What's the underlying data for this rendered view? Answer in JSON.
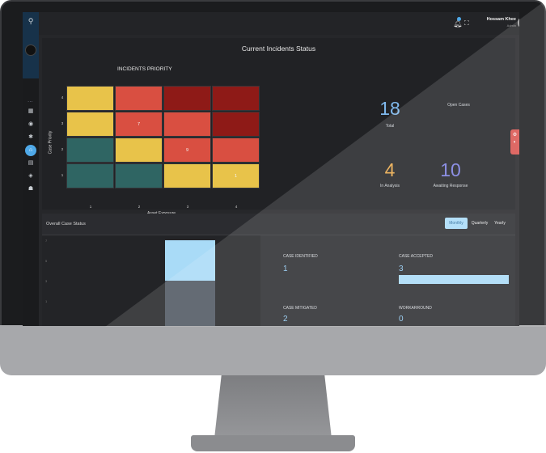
{
  "sidebar": {
    "logo_icon": "shield-logo-icon",
    "dots": "...",
    "items": [
      {
        "icon": "calendar-icon",
        "glyph": "▦"
      },
      {
        "icon": "clock-icon",
        "glyph": "◉"
      },
      {
        "icon": "bug-icon",
        "glyph": "✱"
      },
      {
        "icon": "home-icon",
        "glyph": "⌂",
        "active": true
      },
      {
        "icon": "chat-icon",
        "glyph": "▤"
      },
      {
        "icon": "location-icon",
        "glyph": "◈"
      },
      {
        "icon": "users-icon",
        "glyph": "☗"
      }
    ]
  },
  "topbar": {
    "bell_icon": "bell-icon",
    "expand_icon": "fullscreen-icon",
    "user_name": "Hossam Khee",
    "user_role": "Admin"
  },
  "incidents": {
    "title": "Current Incidents Status",
    "heatmap_title": "INCIDENTS PRIORITY",
    "y_axis_label": "Case Priority",
    "x_axis_label": "Asset Exposure",
    "y_ticks": [
      "4",
      "3",
      "2",
      "1"
    ],
    "x_ticks": [
      "1",
      "2",
      "3",
      "4"
    ],
    "cells": [
      {
        "row": 4,
        "col": 1,
        "color": "#e8c34a",
        "value": ""
      },
      {
        "row": 4,
        "col": 2,
        "color": "#d94f41",
        "value": ""
      },
      {
        "row": 4,
        "col": 3,
        "color": "#8e1a17",
        "value": ""
      },
      {
        "row": 4,
        "col": 4,
        "color": "#8e1a17",
        "value": ""
      },
      {
        "row": 3,
        "col": 1,
        "color": "#e8c34a",
        "value": ""
      },
      {
        "row": 3,
        "col": 2,
        "color": "#d94f41",
        "value": "7"
      },
      {
        "row": 3,
        "col": 3,
        "color": "#d94f41",
        "value": ""
      },
      {
        "row": 3,
        "col": 4,
        "color": "#8e1a17",
        "value": ""
      },
      {
        "row": 2,
        "col": 1,
        "color": "#2f6563",
        "value": ""
      },
      {
        "row": 2,
        "col": 2,
        "color": "#e8c34a",
        "value": ""
      },
      {
        "row": 2,
        "col": 3,
        "color": "#d94f41",
        "value": "9"
      },
      {
        "row": 2,
        "col": 4,
        "color": "#d94f41",
        "value": ""
      },
      {
        "row": 1,
        "col": 1,
        "color": "#2f6563",
        "value": ""
      },
      {
        "row": 1,
        "col": 2,
        "color": "#2f6563",
        "value": ""
      },
      {
        "row": 1,
        "col": 3,
        "color": "#e8c34a",
        "value": ""
      },
      {
        "row": 1,
        "col": 4,
        "color": "#e8c34a",
        "value": "1"
      }
    ],
    "stats": {
      "total_value": "18",
      "total_label": "Total",
      "open_label": "Open Cases",
      "in_analysis_value": "4",
      "in_analysis_label": "In Analysis",
      "awaiting_value": "10",
      "awaiting_label": "Awaiting Response"
    },
    "stat_colors": {
      "total": "#7fb8ec",
      "analysis": "#e8a84a",
      "awaiting": "#7b7fe0"
    }
  },
  "side_tab": {
    "icons": [
      "settings-icon",
      "palette-icon"
    ],
    "glyphs": [
      "⚙",
      "◐"
    ]
  },
  "case_status": {
    "title": "Overall Case Status",
    "tabs": [
      "Monthly",
      "Quarterly",
      "Yearly"
    ],
    "active_tab": "Monthly",
    "y_ticks": [
      "7",
      "5",
      "3",
      "1"
    ],
    "blocks": [
      {
        "label": "CASE IDENTIFIED",
        "value": "1"
      },
      {
        "label": "CASE ACCEPTED",
        "value": "3"
      },
      {
        "label": "CASE MITIGATED",
        "value": "2"
      },
      {
        "label": "WORKARROUND",
        "value": "0"
      }
    ]
  }
}
